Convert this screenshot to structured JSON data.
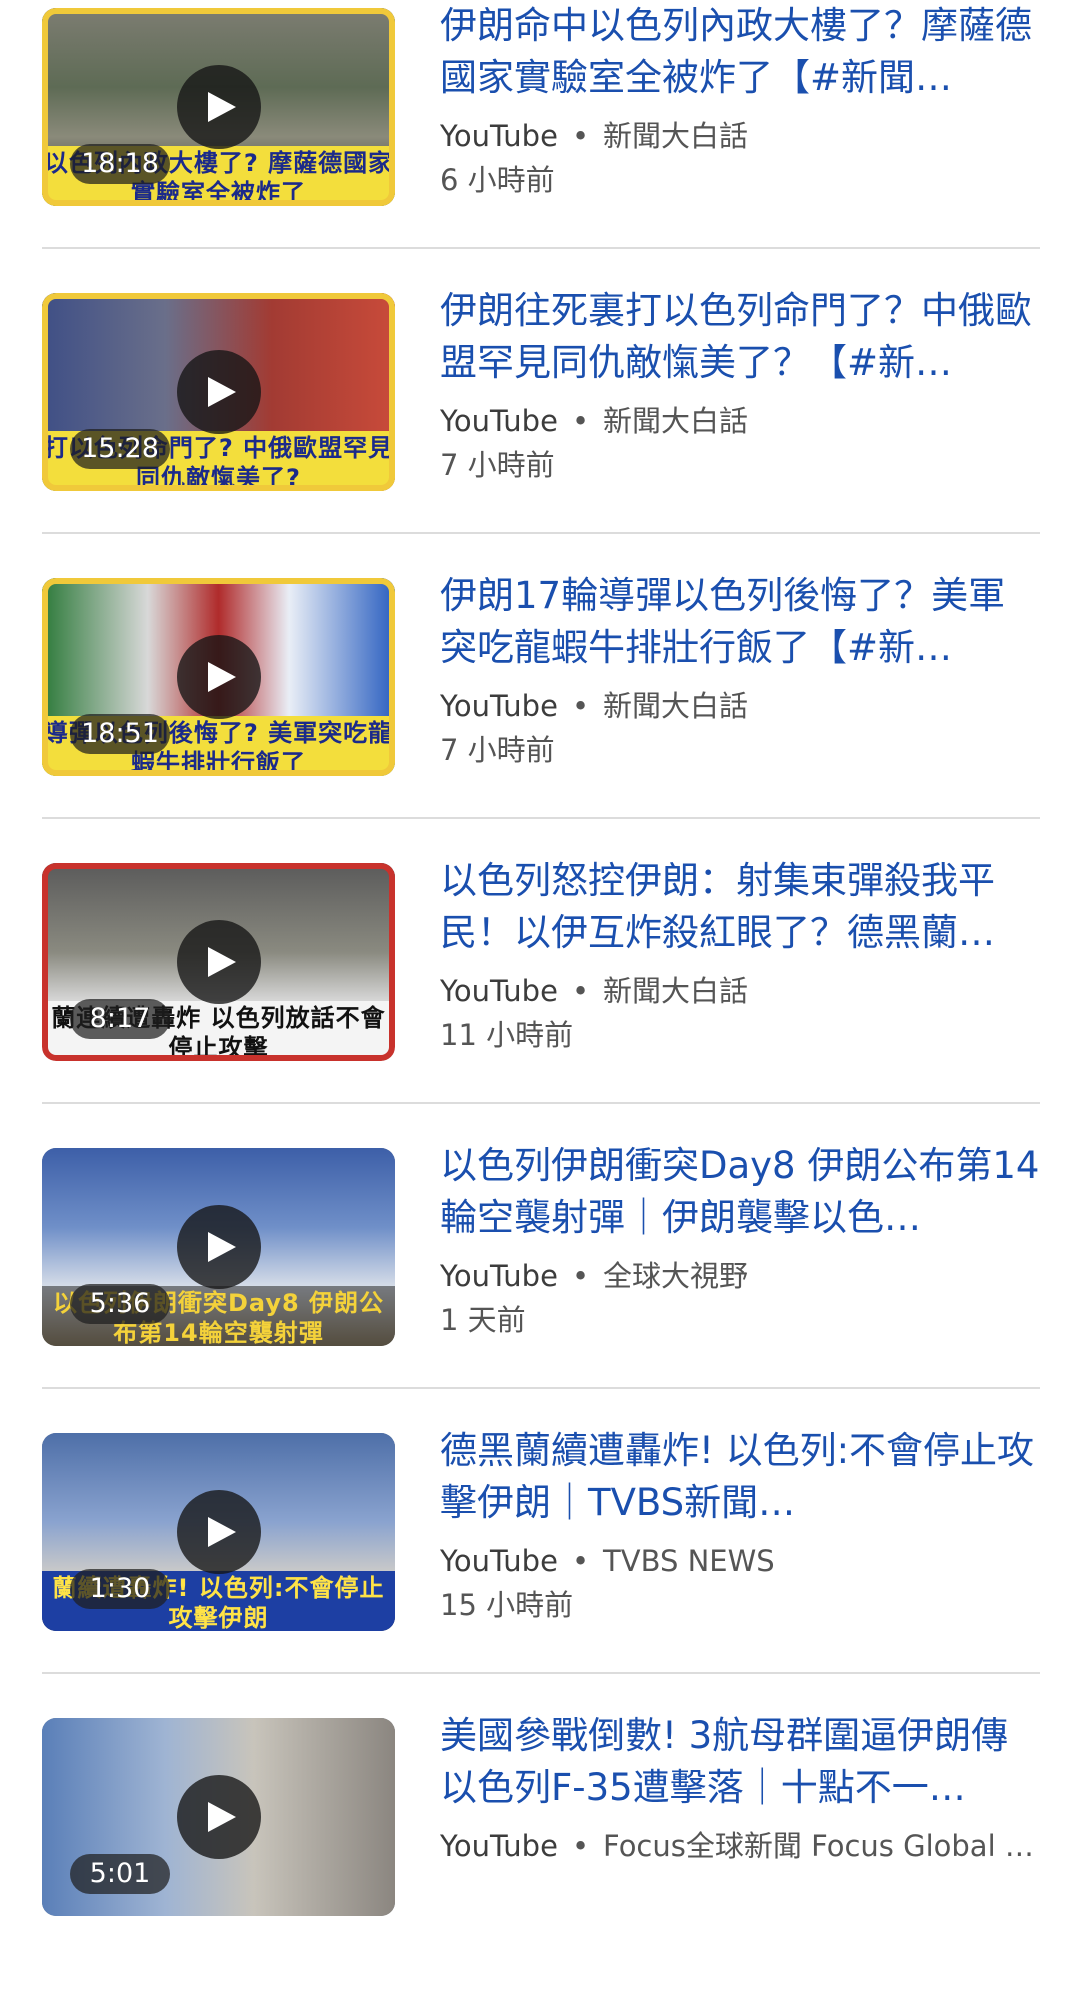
{
  "results": [
    {
      "title": "伊朗命中以色列內政大樓了？摩薩德國家實驗室全被炸了【#新聞…",
      "source": "YouTube",
      "channel": "新聞大白話",
      "time": "6 小時前",
      "duration": "18:18",
      "thumb_caption": "以色列內政大樓了? 摩薩德國家實驗室全被炸了",
      "thumb_style": "yellow"
    },
    {
      "title": "伊朗往死裏打以色列命門了？中俄歐盟罕見同仇敵愾美了？【#新…",
      "source": "YouTube",
      "channel": "新聞大白話",
      "time": "7 小時前",
      "duration": "15:28",
      "thumb_caption": "打以色列命門了? 中俄歐盟罕見同仇敵愾美了?",
      "thumb_style": "yellow"
    },
    {
      "title": "伊朗17輪導彈以色列後悔了？美軍突吃龍蝦牛排壯行飯了【#新…",
      "source": "YouTube",
      "channel": "新聞大白話",
      "time": "7 小時前",
      "duration": "18:51",
      "thumb_caption": "導彈以色列後悔了? 美軍突吃龍蝦牛排壯行飯了",
      "thumb_style": "yellow"
    },
    {
      "title": "以色列怒控伊朗：射集束彈殺我平民！以伊互炸殺紅眼了？德黑蘭…",
      "source": "YouTube",
      "channel": "新聞大白話",
      "time": "11 小時前",
      "duration": "8:17",
      "thumb_caption": "蘭連續遭轟炸 以色列放話不會停止攻擊",
      "thumb_style": "red"
    },
    {
      "title": "以色列伊朗衝突Day8 伊朗公布第14輪空襲射彈｜伊朗襲擊以色…",
      "source": "YouTube",
      "channel": "全球大視野",
      "time": "1 天前",
      "duration": "5:36",
      "thumb_caption": "以色列伊朗衝突Day8 伊朗公布第14輪空襲射彈",
      "thumb_style": "sky"
    },
    {
      "title": "德黑蘭續遭轟炸! 以色列:不會停止攻擊伊朗｜TVBS新聞…",
      "source": "YouTube",
      "channel": "TVBS NEWS",
      "time": "15 小時前",
      "duration": "1:30",
      "thumb_caption": "蘭續遭轟炸! 以色列:不會停止攻擊伊朗",
      "thumb_style": "tvbs"
    },
    {
      "title": "美國參戰倒數! 3航母群圍逼伊朗傳以色列F-35遭擊落｜十點不一…",
      "source": "YouTube",
      "channel": "Focus全球新聞 Focus Global …",
      "time": "",
      "duration": "5:01",
      "thumb_caption": "",
      "thumb_style": "building"
    }
  ],
  "meta_separator": "•",
  "colors": {
    "title": "#1a4fae",
    "meta": "#555555",
    "divider": "#dcdcdc"
  }
}
